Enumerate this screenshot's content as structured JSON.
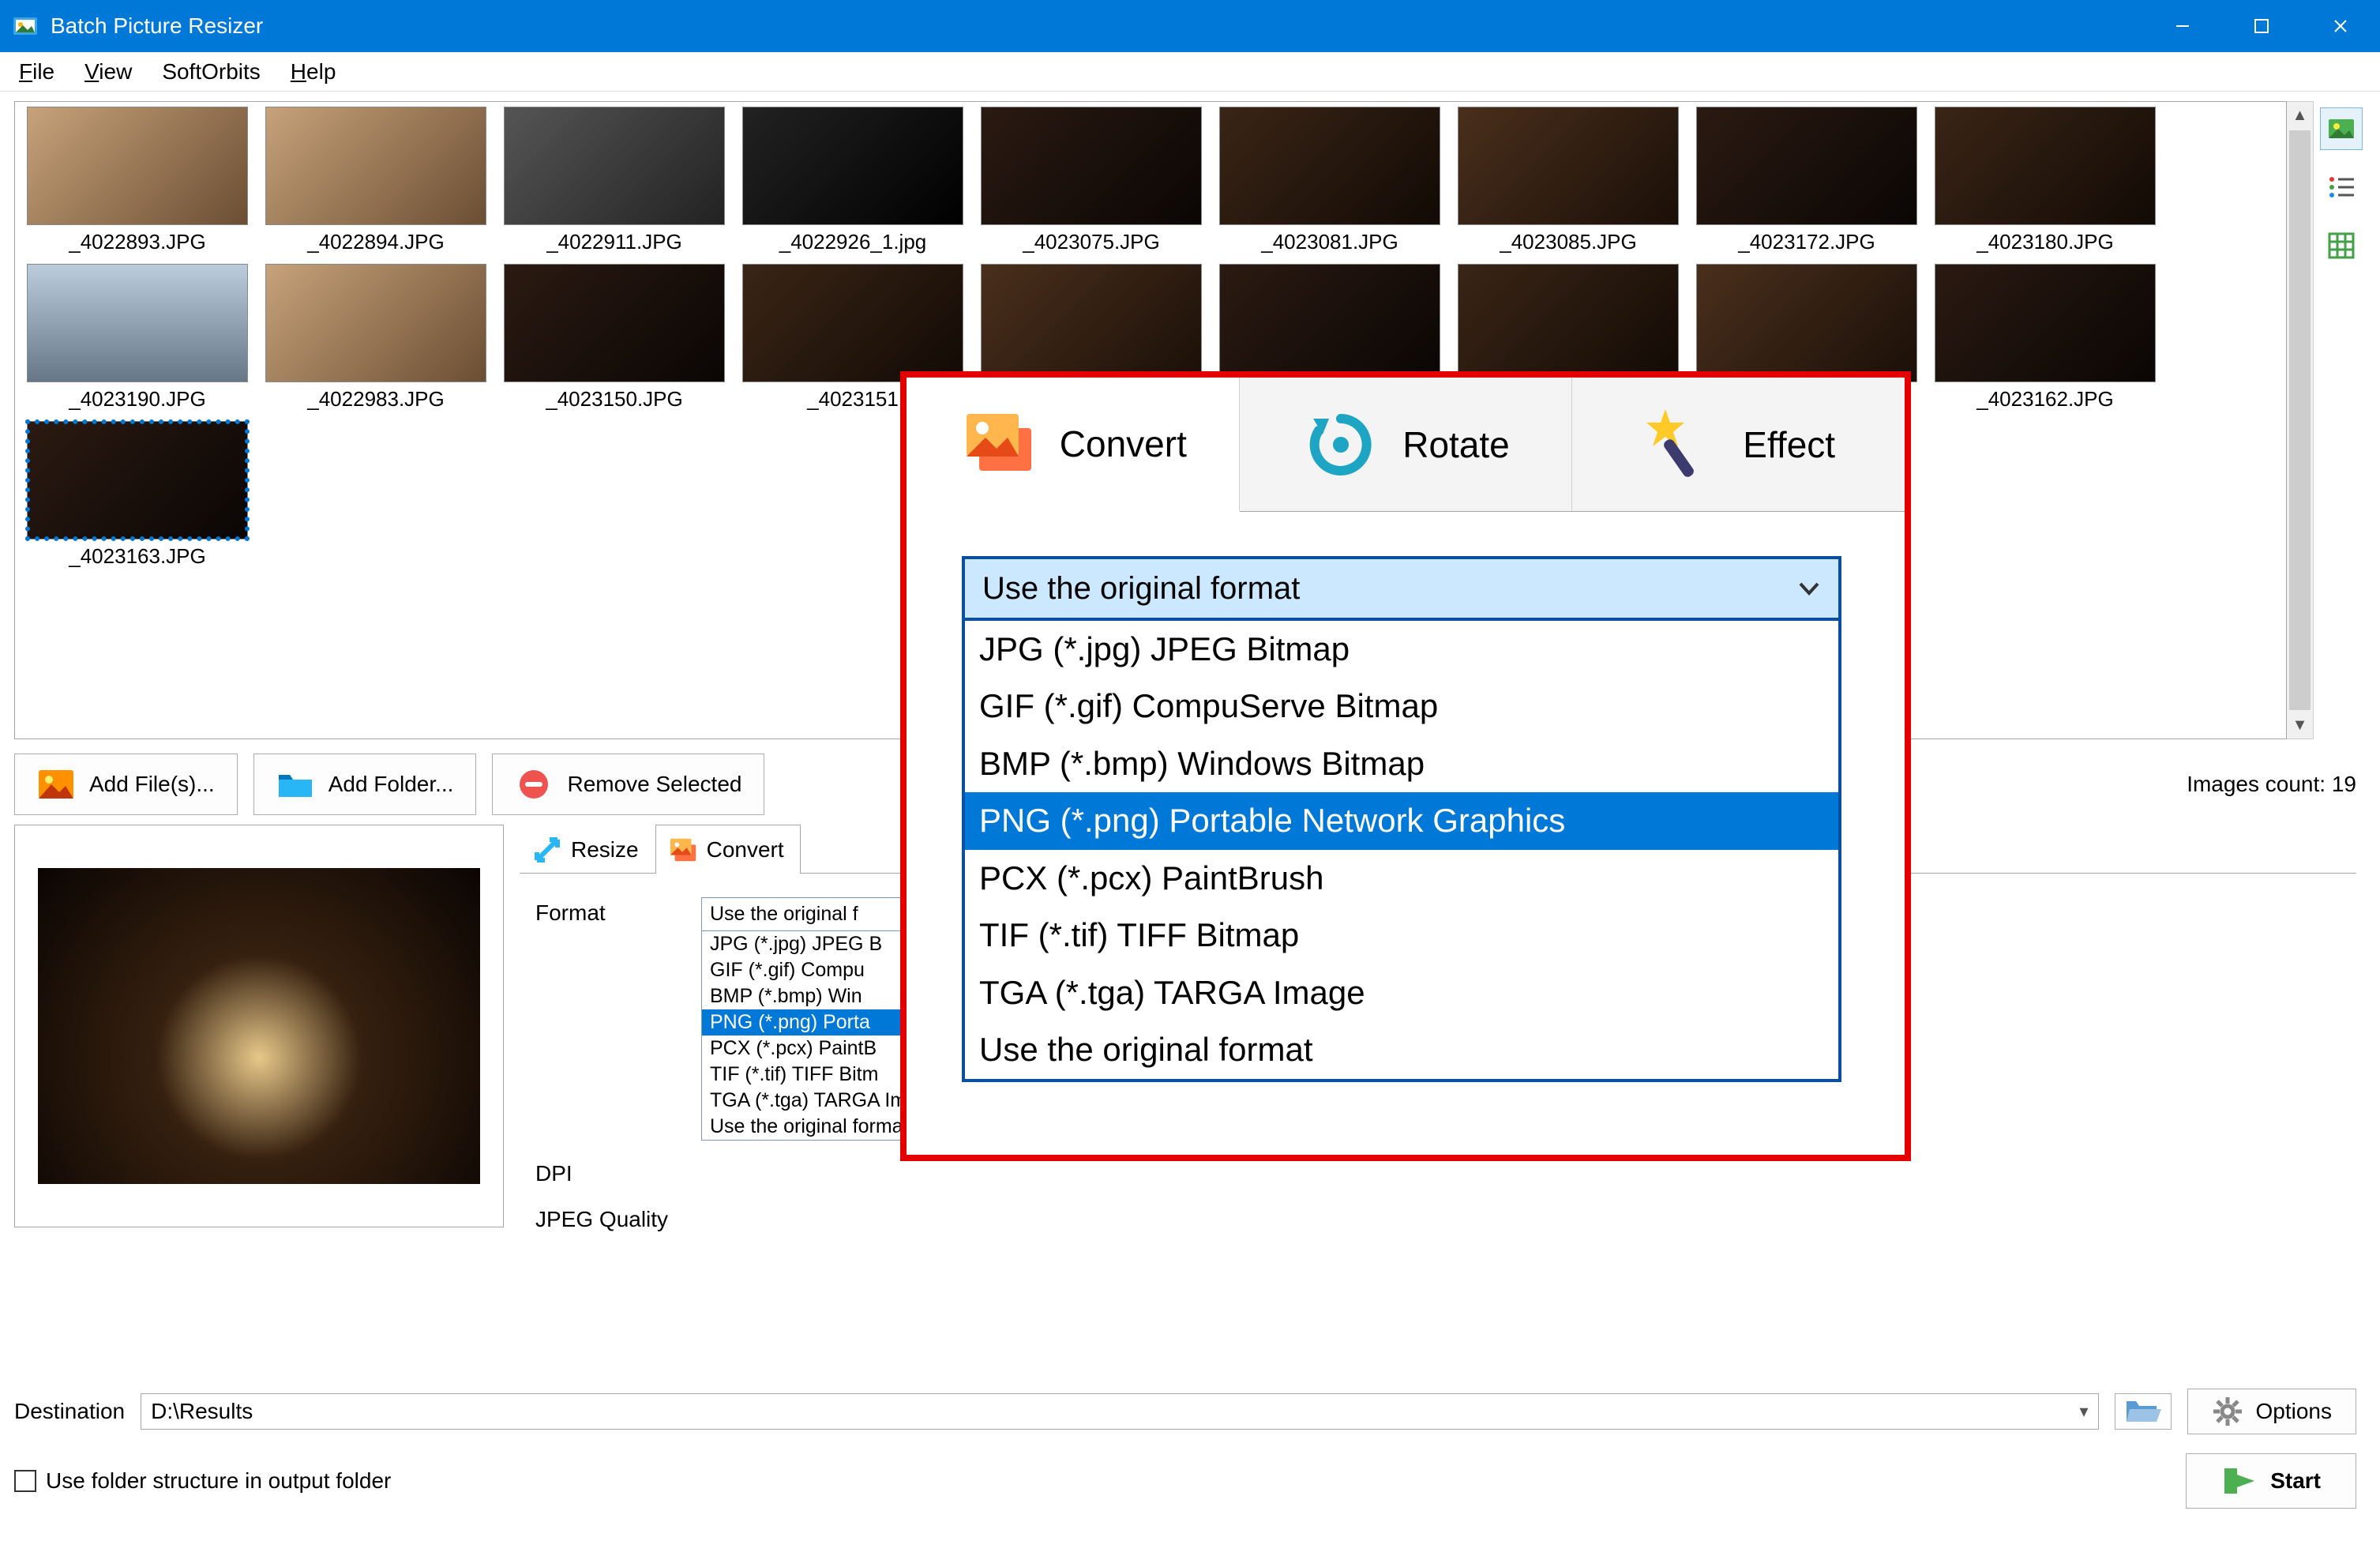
{
  "titlebar": {
    "title": "Batch Picture Resizer"
  },
  "menu": {
    "items": [
      "File",
      "View",
      "SoftOrbits",
      "Help"
    ]
  },
  "view_tools": {
    "active_index": 0
  },
  "gallery": {
    "thumbs": [
      {
        "name": "_4022893.JPG",
        "bg": "bg-f"
      },
      {
        "name": "_4022894.JPG",
        "bg": "bg-f"
      },
      {
        "name": "_4022911.JPG",
        "bg": "bg-g"
      },
      {
        "name": "_4022926_1.jpg",
        "bg": "bg-d"
      },
      {
        "name": "_4023075.JPG",
        "bg": "bg-a"
      },
      {
        "name": "_4023081.JPG",
        "bg": "bg-b"
      },
      {
        "name": "_4023085.JPG",
        "bg": "bg-c"
      },
      {
        "name": "_4023172.JPG",
        "bg": "bg-a"
      },
      {
        "name": "_4023180.JPG",
        "bg": "bg-b"
      },
      {
        "name": "_4023190.JPG",
        "bg": "bg-e"
      },
      {
        "name": "_4022983.JPG",
        "bg": "bg-f"
      },
      {
        "name": "_4023150.JPG",
        "bg": "bg-a"
      },
      {
        "name": "_4023151",
        "bg": "bg-b"
      },
      {
        "name": "",
        "bg": "bg-c"
      },
      {
        "name": "",
        "bg": "bg-a"
      },
      {
        "name": "",
        "bg": "bg-b"
      },
      {
        "name": "",
        "bg": "bg-c"
      },
      {
        "name": "_4023162.JPG",
        "bg": "bg-a"
      },
      {
        "name": "_4023163.JPG",
        "bg": "bg-a",
        "selected": true
      }
    ]
  },
  "actions": {
    "add_files": "Add File(s)...",
    "add_folder": "Add Folder...",
    "remove_selected": "Remove Selected",
    "images_count_label": "Images count: 19"
  },
  "small_tabs": {
    "resize": "Resize",
    "convert": "Convert",
    "active": "convert"
  },
  "settings": {
    "format_label": "Format",
    "dpi_label": "DPI",
    "jpeg_quality_label": "JPEG Quality",
    "format_current": "Use the original f",
    "format_options": [
      "JPG (*.jpg) JPEG B",
      "GIF (*.gif) Compu",
      "BMP (*.bmp) Win",
      "PNG (*.png) Porta",
      "PCX (*.pcx) PaintB",
      "TIF (*.tif) TIFF Bitm",
      "TGA (*.tga) TARGA Image",
      "Use the original format"
    ],
    "format_highlight_index": 3
  },
  "big_callout": {
    "tabs": {
      "convert": "Convert",
      "rotate": "Rotate",
      "effect": "Effect",
      "active": "convert"
    },
    "select_current": "Use the original format",
    "options": [
      "JPG (*.jpg) JPEG Bitmap",
      "GIF (*.gif) CompuServe Bitmap",
      "BMP (*.bmp) Windows Bitmap",
      "PNG (*.png) Portable Network Graphics",
      "PCX (*.pcx) PaintBrush",
      "TIF (*.tif) TIFF Bitmap",
      "TGA (*.tga) TARGA Image",
      "Use the original format"
    ],
    "highlight_index": 3
  },
  "bottom": {
    "destination_label": "Destination",
    "destination_value": "D:\\Results",
    "options_label": "Options",
    "use_folder_structure_label": "Use folder structure in output folder",
    "start_label": "Start"
  }
}
